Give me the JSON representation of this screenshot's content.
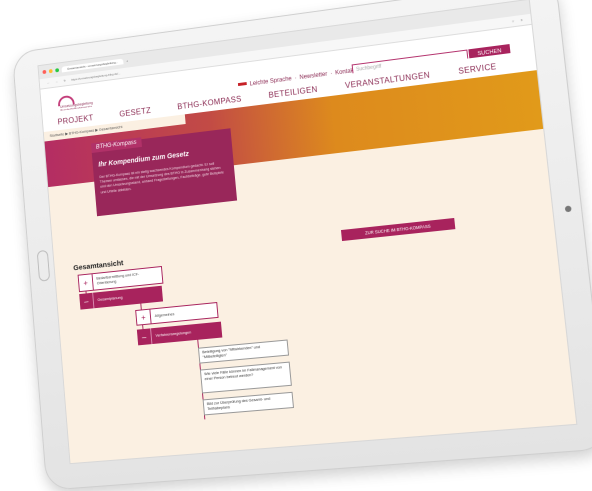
{
  "browser": {
    "tab_title": "Gesamtansicht - umsetzungsbegleitung...",
    "url": "https://umsetzungsbegleitung-bthg.de/..."
  },
  "header": {
    "logo_text": "Umsetzungsbegleitung\nBundesteilhabegesetz",
    "leichte_sprache": "Leichte Sprache",
    "newsletter": "Newsletter",
    "kontakt": "Kontakt",
    "separator": "·",
    "search_placeholder": "Suchbegriff",
    "search_button": "SUCHEN"
  },
  "nav": {
    "items": [
      "PROJEKT",
      "GESETZ",
      "BTHG-KOMPASS",
      "BETEILIGEN",
      "VERANSTALTUNGEN",
      "SERVICE"
    ]
  },
  "breadcrumb": "Startseite ▶ BTHG-Kompass ▶ Gesamtansicht",
  "card": {
    "tag": "BTHG-Kompass",
    "title": "Ihr Kompendium zum Gesetz",
    "body": "Der BTHG-Kompass ist ein stetig wachsendes Kompendium gedacht. Er soll Themen umfassen, die mit der Umsetzung des BTHG in Zusammenhang stehen und den Umsetzungsstand, anhand Fragestellungen, Fachbeiträge, gute Beispiele und Urteile abbilden."
  },
  "section_title": "Gesamtansicht",
  "cta_button": "ZUR SUCHE IM BTHG-KOMPASS",
  "tree": {
    "node1": {
      "sign": "+",
      "label": "Bedarfsermittlung und ICF-Orientierung"
    },
    "node2": {
      "sign": "–",
      "label": "Gesamtplanung"
    },
    "node3": {
      "sign": "+",
      "label": "Allgemeines"
    },
    "node4": {
      "sign": "–",
      "label": "Verfahrensregelungen"
    },
    "leaves": [
      "Beteiligung von \"Mitwirkenden\" und \"Mitbeteiligten\"",
      "Wie viele Fälle können im Fallmanagement von einer Person betreut werden?",
      "Bild zur Überprüfung des Gesamt- und Teilhabeplans"
    ]
  }
}
